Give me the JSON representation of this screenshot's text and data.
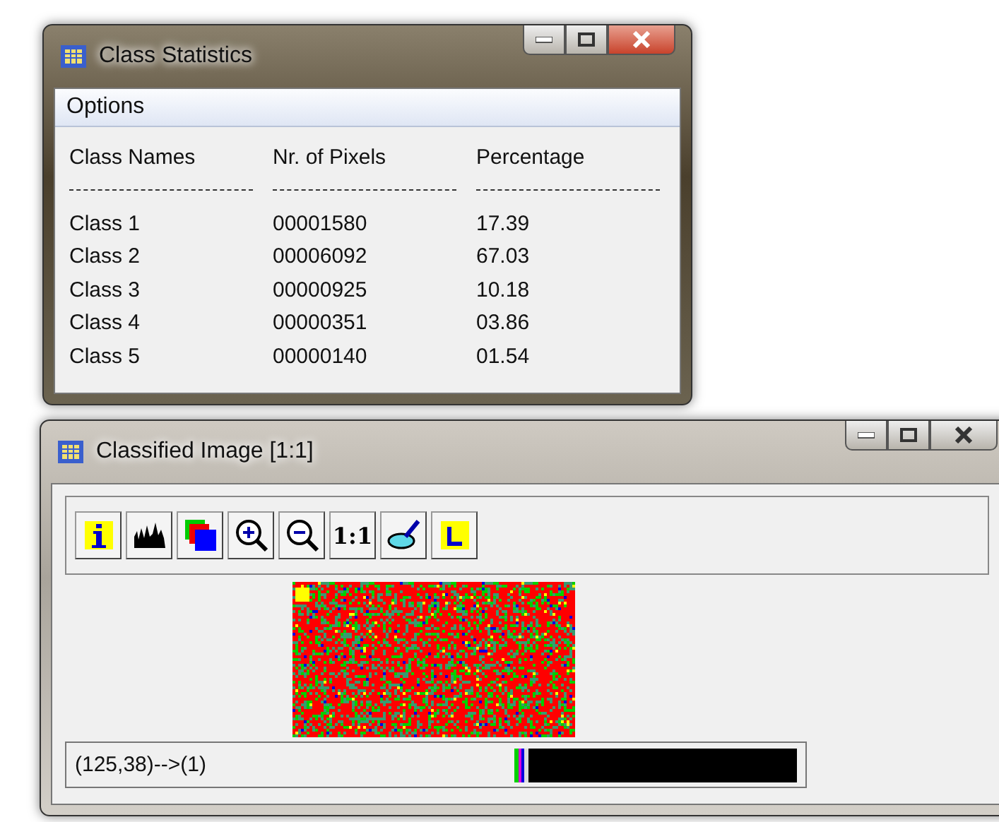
{
  "windows": [
    {
      "kind": "stats",
      "title": "Class Statistics",
      "active": true,
      "menu": [
        "Options"
      ],
      "columns": [
        "Class Names",
        "Nr. of Pixels",
        "Percentage"
      ],
      "rows": [
        [
          "Class 1",
          "00001580",
          "17.39"
        ],
        [
          "Class 2",
          "00006092",
          "67.03"
        ],
        [
          "Class 3",
          "00000925",
          "10.18"
        ],
        [
          "Class 4",
          "00000351",
          "03.86"
        ],
        [
          "Class 5",
          "00000140",
          "01.54"
        ]
      ]
    },
    {
      "kind": "image",
      "title": "Classified Image [1:1]",
      "active": false,
      "tools": [
        {
          "kind": "info"
        },
        {
          "kind": "histogram"
        },
        {
          "kind": "layers"
        },
        {
          "kind": "zoom-in"
        },
        {
          "kind": "zoom-out"
        },
        {
          "kind": "text",
          "label": "1:1"
        },
        {
          "kind": "dish"
        },
        {
          "kind": "legend"
        }
      ],
      "status": "(125,38)-->(1)"
    }
  ]
}
